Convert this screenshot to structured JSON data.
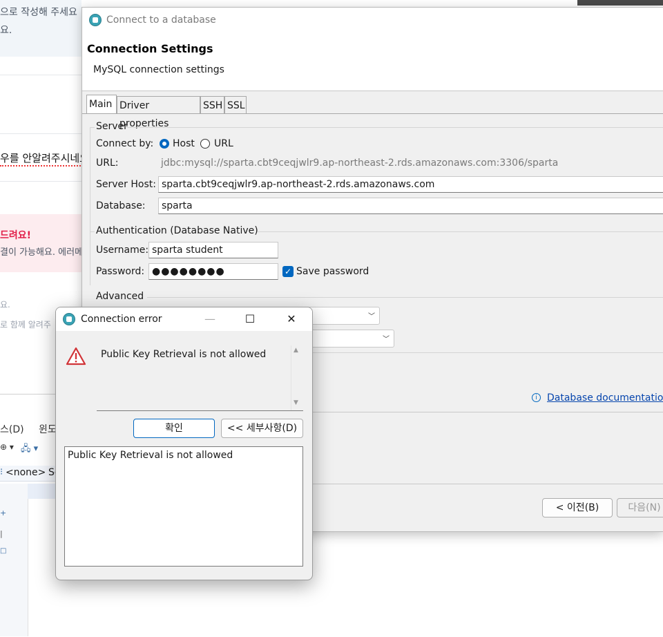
{
  "background": {
    "top_text_1": "으로 작성해 주세요",
    "top_text_2": "요.",
    "mid_text": "우를 안알려주시네요",
    "pink_title": "드려요!",
    "pink_text": "결이 가능해요. 에러메",
    "lower_text_1": "요.",
    "lower_text_2": "로 함께 알려주",
    "ide_menu_1": "스(D)",
    "ide_menu_2": "윈도",
    "ide_none_label": "<none>",
    "ide_sc": "Sc"
  },
  "db_dialog": {
    "title": "Connect to a database",
    "header_title": "Connection Settings",
    "header_subtitle": "MySQL connection settings",
    "tabs": [
      {
        "label": "Main"
      },
      {
        "label": "Driver properties"
      },
      {
        "label": "SSH"
      },
      {
        "label": "SSL"
      }
    ],
    "server": {
      "group_label": "Server",
      "connect_by_label": "Connect by:",
      "option_host": "Host",
      "option_url": "URL",
      "url_label": "URL:",
      "url_value": "jdbc:mysql://sparta.cbt9ceqjwlr9.ap-northeast-2.rds.amazonaws.com:3306/sparta",
      "host_label": "Server Host:",
      "host_value": "sparta.cbt9ceqjwlr9.ap-northeast-2.rds.amazonaws.com",
      "database_label": "Database:",
      "database_value": "sparta"
    },
    "auth": {
      "group_label": "Authentication (Database Native)",
      "username_label": "Username:",
      "username_value": "sparta student",
      "password_label": "Password:",
      "password_mask": "●●●●●●●●",
      "save_password_label": "Save password"
    },
    "advanced": {
      "group_label": "Advanced"
    },
    "doc_link": "Database documentation",
    "buttons": {
      "back": "< 이전(B)",
      "next": "다음(N)"
    }
  },
  "error_dialog": {
    "title": "Connection error",
    "message": "Public Key Retrieval is not allowed",
    "ok_button": "확인",
    "details_button": "<< 세부사항(D)",
    "details_text": "Public Key Retrieval is not allowed",
    "minimize": "—",
    "maximize": "☐",
    "close": "✕"
  },
  "colors": {
    "accent": "#0067c0",
    "warning": "#d13438",
    "link": "#0645ad"
  }
}
